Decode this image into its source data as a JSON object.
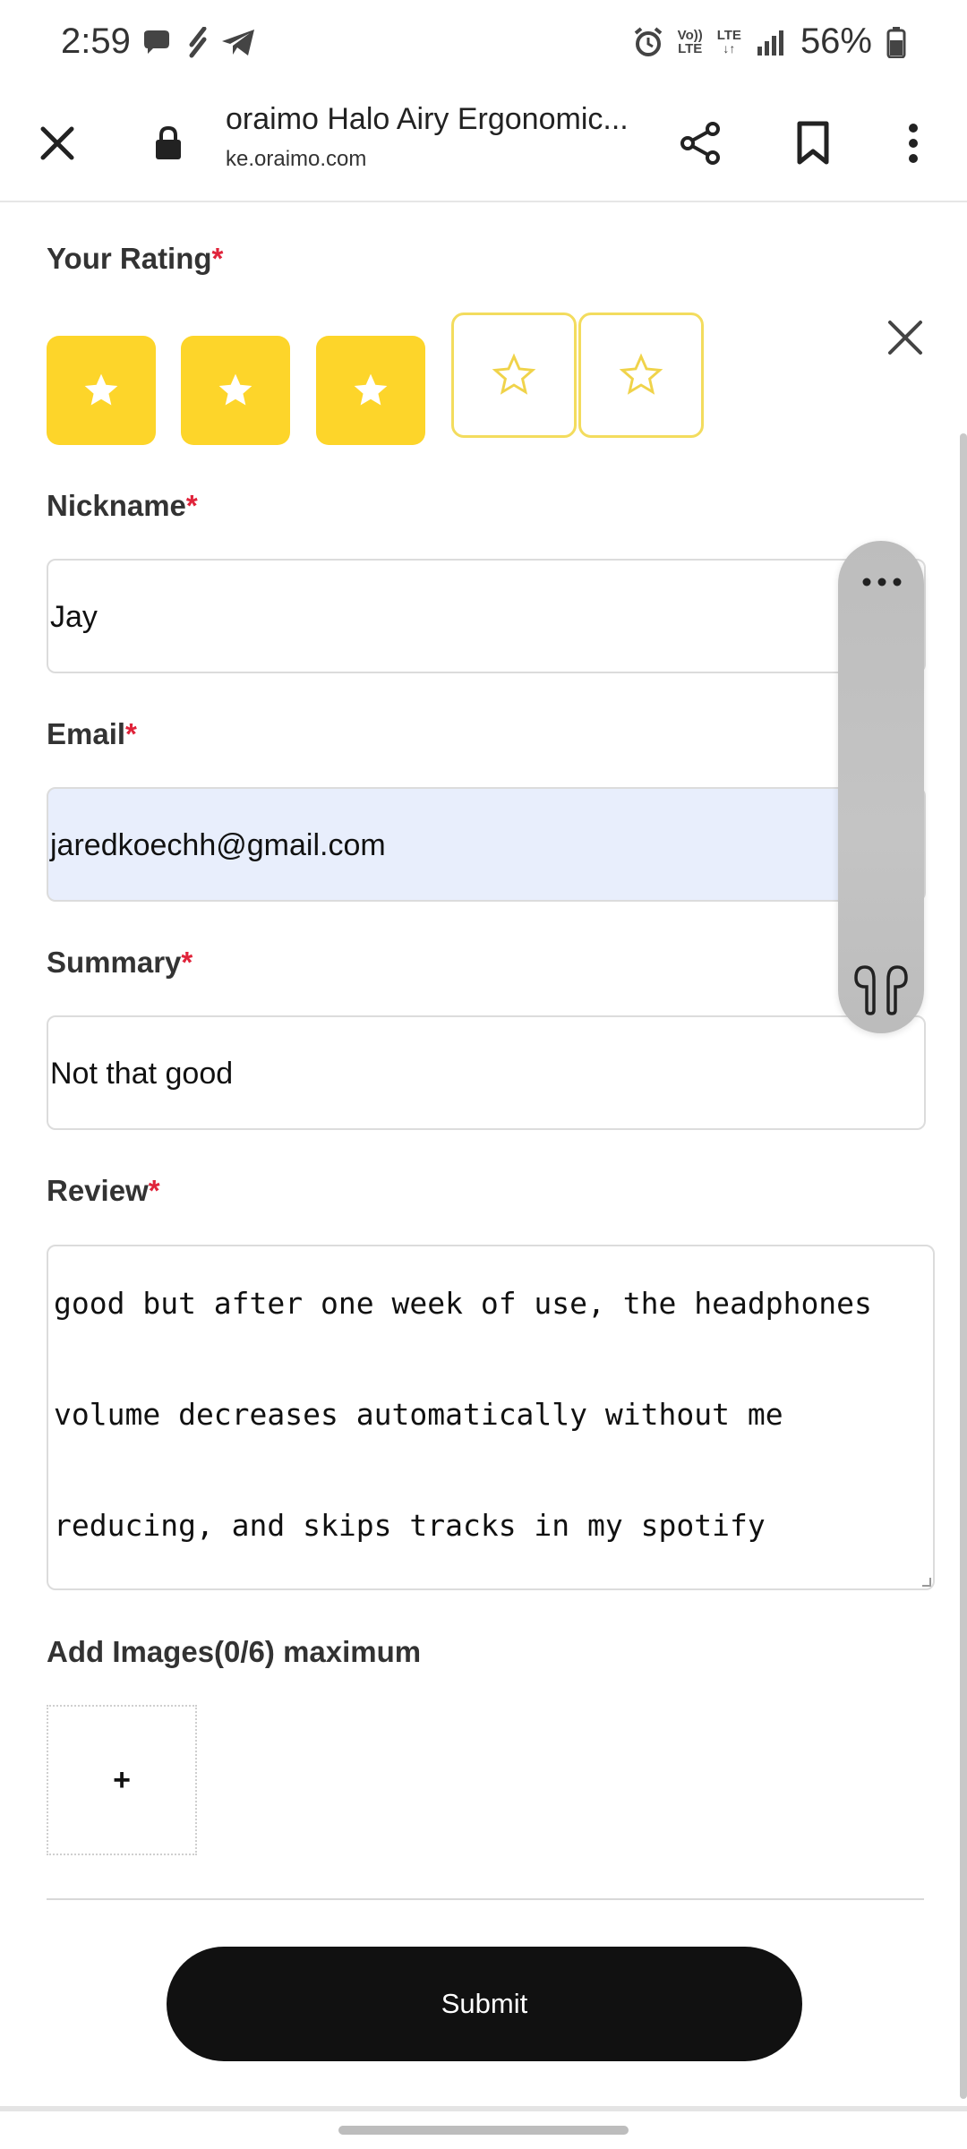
{
  "status_bar": {
    "time": "2:59",
    "left_icons": [
      "chat-bubble-icon",
      "stylus-icon",
      "telegram-icon"
    ],
    "volte_line1": "Vo))",
    "volte_line2": "LTE",
    "lte_label": "LTE",
    "battery": "56%"
  },
  "browser": {
    "page_title": "oraimo Halo Airy Ergonomic...",
    "url": "ke.oraimo.com"
  },
  "form": {
    "rating": {
      "label": "Your Rating",
      "required": "*",
      "value": 3,
      "max": 5
    },
    "nickname": {
      "label": "Nickname",
      "required": "*",
      "value": "Jay"
    },
    "email": {
      "label": "Email",
      "required": "*",
      "value": "jaredkoechh@gmail.com"
    },
    "summary": {
      "label": "Summary",
      "required": "*",
      "value": "Not that good"
    },
    "review": {
      "label": "Review",
      "required": "*",
      "lines": [
        "good but after one week of use, the headphones",
        "volume decreases automatically without me",
        "reducing, and skips tracks in my spotify"
      ]
    },
    "images": {
      "label": "Add Images(0/6) maximum",
      "add_symbol": "+"
    },
    "submit_label": "Submit"
  },
  "colors": {
    "star_fill": "#fdd52a",
    "required": "#e0233a",
    "autofill_bg": "#e8eefc",
    "submit_bg": "#111111"
  }
}
